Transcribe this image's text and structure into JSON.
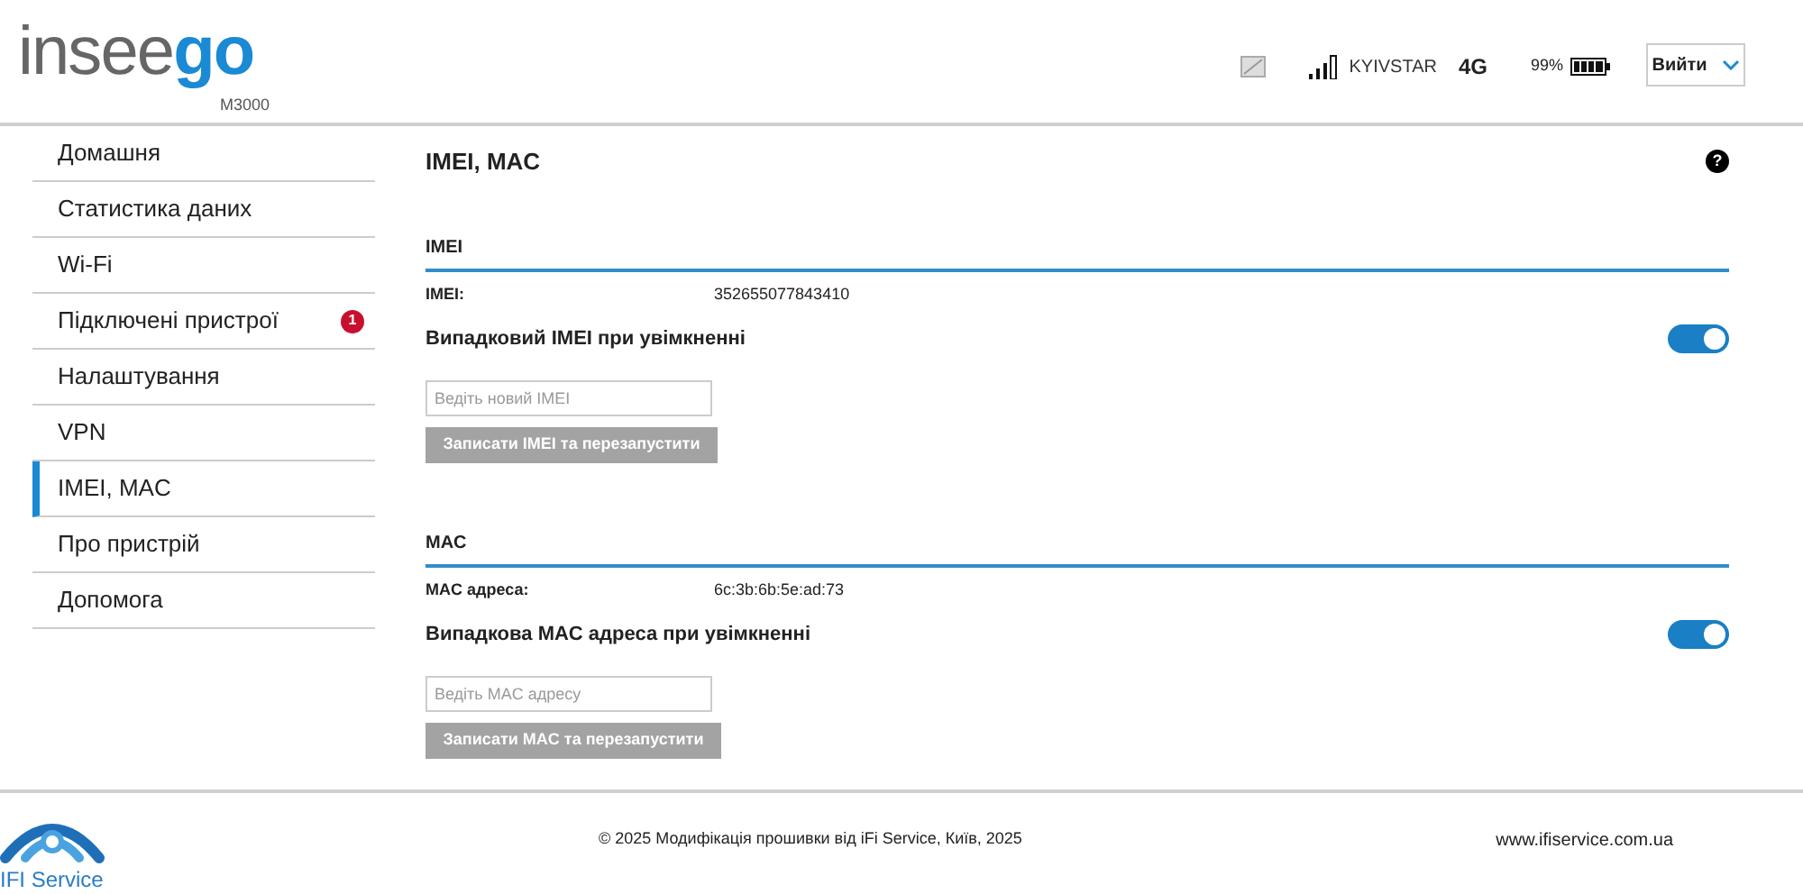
{
  "header": {
    "brand_light": "insee",
    "brand_bold": "go",
    "model": "M3000",
    "operator": "KYIVSTAR",
    "network": "4G",
    "battery": "99%",
    "logout": "Вийти"
  },
  "sidebar": {
    "items": [
      {
        "label": "Домашня",
        "selected": false
      },
      {
        "label": "Статистика даних",
        "selected": false
      },
      {
        "label": "Wi-Fi",
        "selected": false
      },
      {
        "label": "Підключені пристрої",
        "selected": false,
        "badge": "1"
      },
      {
        "label": "Налаштування",
        "selected": false
      },
      {
        "label": "VPN",
        "selected": false
      },
      {
        "label": "IMEI, MAC",
        "selected": true
      },
      {
        "label": "Про пристрій",
        "selected": false
      },
      {
        "label": "Допомога",
        "selected": false
      }
    ]
  },
  "page": {
    "title": "IMEI, MAC",
    "help": "?"
  },
  "sections": [
    {
      "heading": "IMEI",
      "field_label": "IMEI:",
      "field_value": "352655077843410",
      "toggle_label": "Випадковий IMEI при увімкненні",
      "toggle_on": true,
      "placeholder": "Ведіть новий IMEI",
      "button": "Записати IMEI та перезапустити"
    },
    {
      "heading": "MAC",
      "field_label": "MAC адреса:",
      "field_value": "6c:3b:6b:5e:ad:73",
      "toggle_label": "Випадкова MAC адреса при увімкненні",
      "toggle_on": true,
      "placeholder": "Ведіть MAC адресу",
      "button": "Записати MAC та перезапустити"
    }
  ],
  "footer": {
    "logo_text": "IFI Service",
    "copyright": "© 2025 Модифікація прошивки від iFi Service, Київ, 2025",
    "website": "www.ifiservice.com.ua"
  }
}
